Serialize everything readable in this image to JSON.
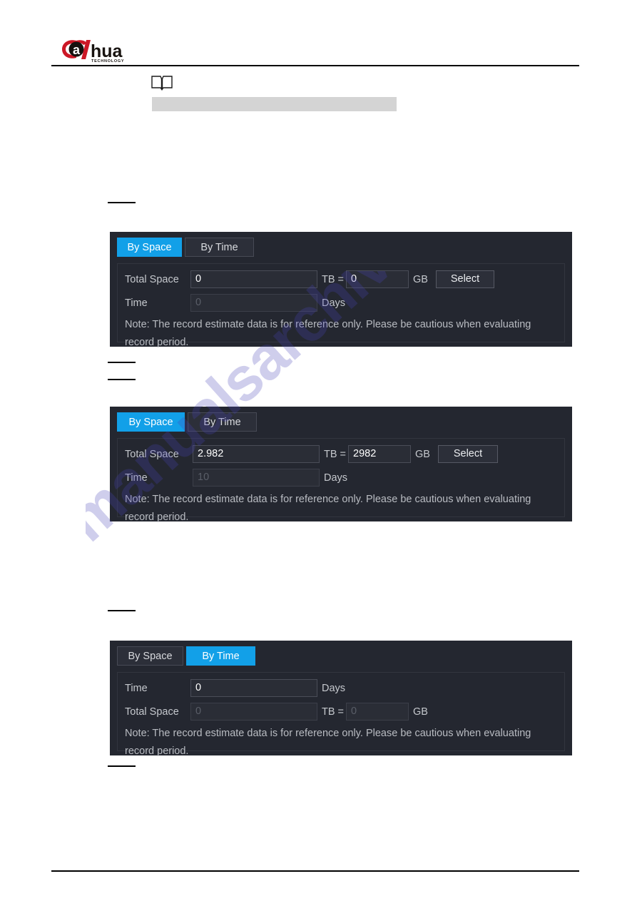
{
  "document": {
    "brand": "dahua",
    "brand_sub": "TECHNOLOGY",
    "watermark": "manualsarchive.com",
    "note_icon": "book-icon"
  },
  "panels": [
    {
      "id": "panel-by-space-empty",
      "tabs": [
        {
          "label": "By Space",
          "active": true
        },
        {
          "label": "By Time",
          "active": false
        }
      ],
      "fields": [
        {
          "label": "Total Space",
          "value": "0",
          "unit1": "TB =",
          "value2": "0",
          "unit2": "GB",
          "button": "Select",
          "disabled": false
        },
        {
          "label": "Time",
          "value": "0",
          "unit1": "Days",
          "disabled": true
        }
      ],
      "note": "Note: The record estimate data is for reference only. Please be cautious when evaluating record period."
    },
    {
      "id": "panel-by-space-filled",
      "tabs": [
        {
          "label": "By Space",
          "active": true
        },
        {
          "label": "By Time",
          "active": false
        }
      ],
      "fields": [
        {
          "label": "Total Space",
          "value": "2.982",
          "unit1": "TB =",
          "value2": "2982",
          "unit2": "GB",
          "button": "Select",
          "disabled": false
        },
        {
          "label": "Time",
          "value": "10",
          "unit1": "Days",
          "disabled": true
        }
      ],
      "note": "Note: The record estimate data is for reference only. Please be cautious when evaluating record period."
    },
    {
      "id": "panel-by-time",
      "tabs": [
        {
          "label": "By Space",
          "active": false
        },
        {
          "label": "By Time",
          "active": true
        }
      ],
      "fields": [
        {
          "label": "Time",
          "value": "0",
          "unit1": "Days",
          "disabled": false
        },
        {
          "label": "Total Space",
          "value": "0",
          "unit1": "TB =",
          "value2": "0",
          "unit2": "GB",
          "disabled": true
        }
      ],
      "note": "Note: The record estimate data is for reference only. Please be cautious when evaluating record period."
    }
  ],
  "colors": {
    "accent_blue": "#12a0e8",
    "panel_bg": "#242730",
    "logo_red": "#cc1826",
    "redaction_grey": "#d4d4d4"
  }
}
